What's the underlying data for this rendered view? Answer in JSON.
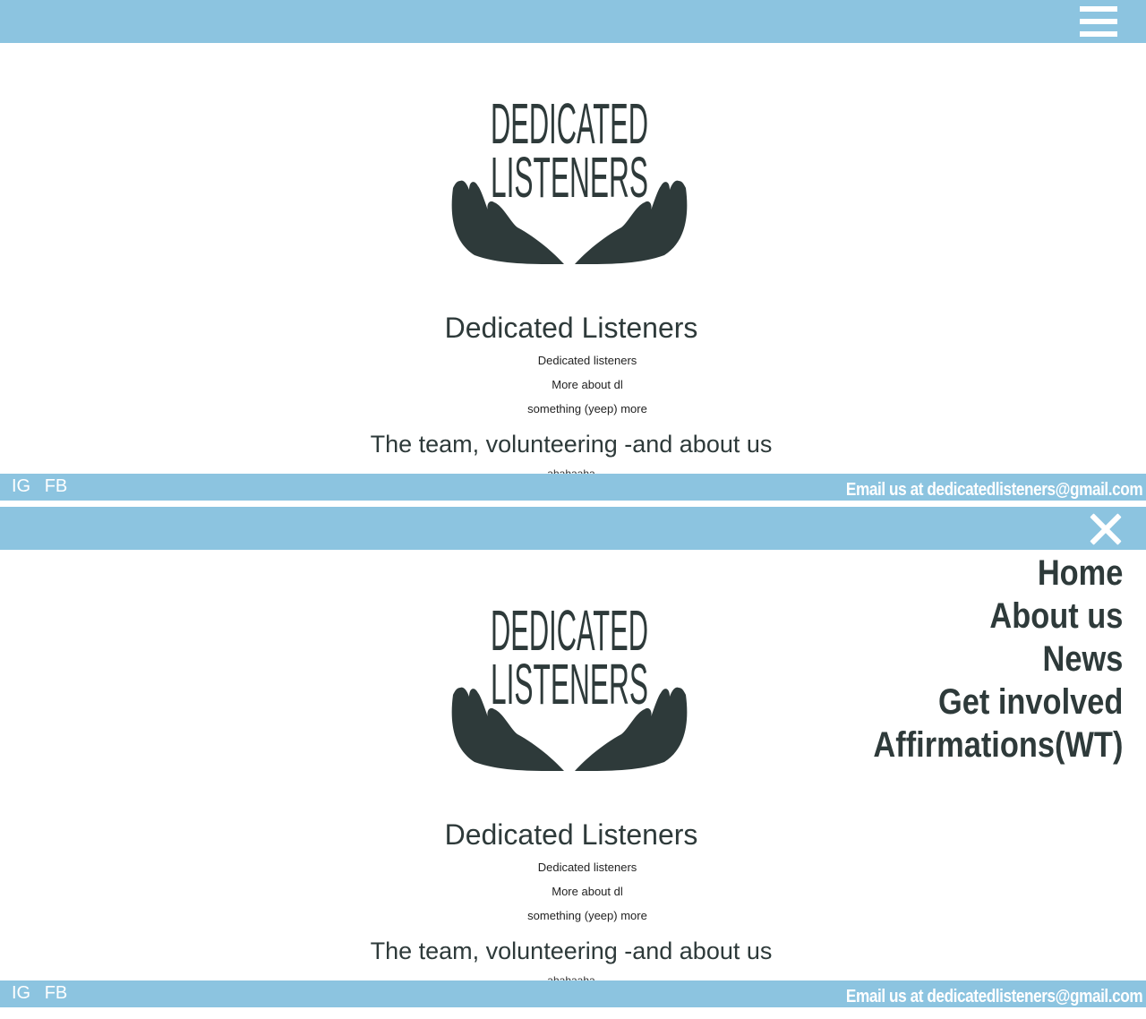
{
  "header": {
    "menu_icon": "hamburger-icon",
    "close_icon": "close-icon"
  },
  "logo": {
    "line1": "DEDICATED",
    "line2": "LISTENERS",
    "icon": "open-hands-icon"
  },
  "main": {
    "title": "Dedicated Listeners",
    "subtitle1": "Dedicated listeners",
    "subtitle2": "More about dl",
    "subtitle3": "something (yeep) more",
    "section_heading": "The team, volunteering -and about us",
    "cut_text": "ahahaaha"
  },
  "footer": {
    "ig": "IG",
    "fb": "FB",
    "email": "Email us at dedicatedlisteners@gmail.com"
  },
  "nav": {
    "items": [
      {
        "label": "Home"
      },
      {
        "label": "About us"
      },
      {
        "label": "News"
      },
      {
        "label": "Get involved"
      },
      {
        "label": "Affirmations(WT)"
      }
    ]
  },
  "colors": {
    "bar": "#8cc4e0",
    "text": "#2e3a3a"
  }
}
